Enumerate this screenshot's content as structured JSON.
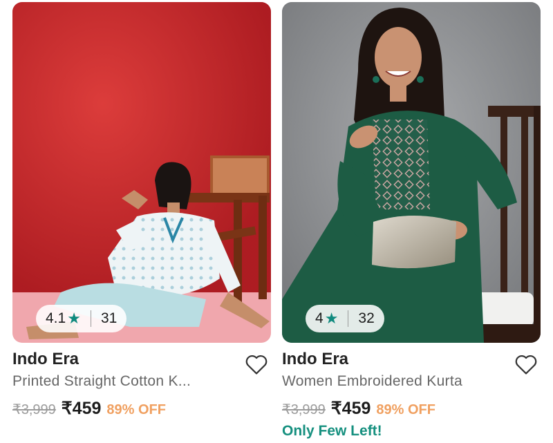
{
  "products": [
    {
      "brand": "Indo Era",
      "title": "Printed Straight Cotton K...",
      "rating": "4.1",
      "rating_count": "31",
      "mrp": "₹3,999",
      "price": "₹459",
      "discount": "89% OFF",
      "stock_note": "",
      "image": "Woman in white printed kurta with blue trim sitting on floor against red wall beside wooden chair"
    },
    {
      "brand": "Indo Era",
      "title": "Women Embroidered Kurta",
      "rating": "4",
      "rating_count": "32",
      "mrp": "₹3,999",
      "price": "₹459",
      "discount": "89% OFF",
      "stock_note": "Only Few Left!",
      "image": "Woman in green embroidered kurta holding silver clutch seated on dark wooden chair against grey wall"
    }
  ],
  "icons": {
    "rating": "star-icon",
    "wishlist": "heart-outline-icon"
  },
  "colors": {
    "star": "#0f8a7e",
    "discount": "#f0a060",
    "stock": "#16907f"
  }
}
